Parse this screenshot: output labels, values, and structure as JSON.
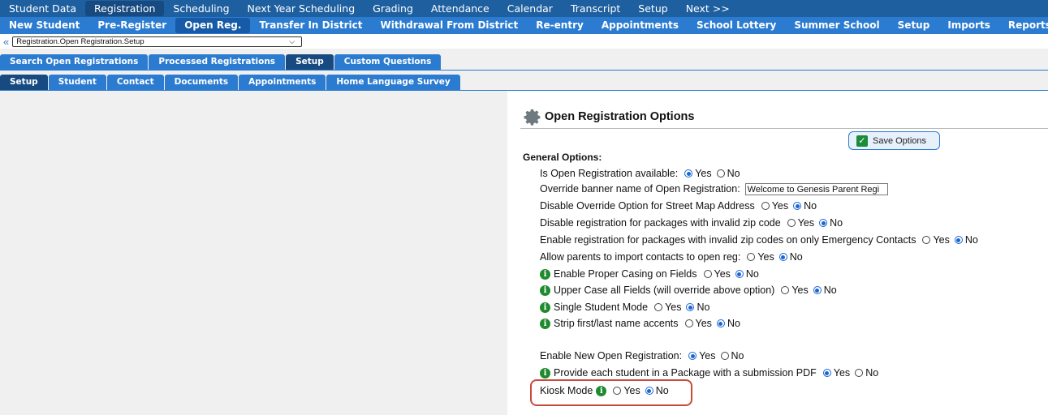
{
  "nav_primary": [
    {
      "label": "Student Data",
      "active": false
    },
    {
      "label": "Registration",
      "active": true
    },
    {
      "label": "Scheduling",
      "active": false
    },
    {
      "label": "Next Year Scheduling",
      "active": false
    },
    {
      "label": "Grading",
      "active": false
    },
    {
      "label": "Attendance",
      "active": false
    },
    {
      "label": "Calendar",
      "active": false
    },
    {
      "label": "Transcript",
      "active": false
    },
    {
      "label": "Setup",
      "active": false
    },
    {
      "label": "Next >>",
      "active": false
    }
  ],
  "nav_secondary": [
    {
      "label": "New Student",
      "active": false
    },
    {
      "label": "Pre-Register",
      "active": false
    },
    {
      "label": "Open Reg.",
      "active": true
    },
    {
      "label": "Transfer In District",
      "active": false
    },
    {
      "label": "Withdrawal From District",
      "active": false
    },
    {
      "label": "Re-entry",
      "active": false
    },
    {
      "label": "Appointments",
      "active": false
    },
    {
      "label": "School Lottery",
      "active": false
    },
    {
      "label": "Summer School",
      "active": false
    },
    {
      "label": "Setup",
      "active": false
    },
    {
      "label": "Imports",
      "active": false
    },
    {
      "label": "Reports",
      "active": false
    }
  ],
  "breadcrumb": {
    "back_icon": "double-chevron-left-icon",
    "selected": "Registration.Open Registration.Setup"
  },
  "tabs_top": [
    {
      "label": "Search Open Registrations",
      "active": false
    },
    {
      "label": "Processed Registrations",
      "active": false
    },
    {
      "label": "Setup",
      "active": true
    },
    {
      "label": "Custom Questions",
      "active": false
    }
  ],
  "tabs_sub": [
    {
      "label": "Setup",
      "active": true
    },
    {
      "label": "Student",
      "active": false
    },
    {
      "label": "Contact",
      "active": false
    },
    {
      "label": "Documents",
      "active": false
    },
    {
      "label": "Appointments",
      "active": false
    },
    {
      "label": "Home Language Survey",
      "active": false
    }
  ],
  "panel": {
    "title": "Open Registration Options",
    "save_label": "Save Options",
    "section_label": "General Options:",
    "yes": "Yes",
    "no": "No",
    "options": [
      {
        "label": "Is Open Registration available:",
        "info": false,
        "value": "yes"
      },
      {
        "label": "Override banner name of Open Registration:",
        "info": false,
        "input": "Welcome to Genesis Parent Regi"
      },
      {
        "label": "Disable Override Option for Street Map Address",
        "info": false,
        "value": "no"
      },
      {
        "label": "Disable registration for packages with invalid zip code",
        "info": false,
        "value": "no"
      },
      {
        "label": "Enable registration for packages with invalid zip codes on only Emergency Contacts",
        "info": false,
        "value": "no"
      },
      {
        "label": "Allow parents to import contacts to open reg:",
        "info": false,
        "value": "no"
      },
      {
        "label": "Enable Proper Casing on Fields",
        "info": true,
        "value": "no"
      },
      {
        "label": "Upper Case all Fields (will override above option)",
        "info": true,
        "value": "no"
      },
      {
        "label": "Single Student Mode",
        "info": true,
        "value": "no"
      },
      {
        "label": "Strip first/last name accents",
        "info": true,
        "value": "no"
      },
      {
        "label": "Enable New Open Registration:",
        "info": false,
        "value": "yes"
      },
      {
        "label": "Provide each student in a Package with a submission PDF",
        "info": true,
        "value": "yes"
      },
      {
        "label": "Kiosk Mode",
        "info": true,
        "info_after": true,
        "value": "no",
        "highlighted": true
      }
    ]
  },
  "colors": {
    "nav_primary_bg": "#1e5fa0",
    "nav_secondary_bg": "#2b7bd0",
    "tab_active_bg": "#174a80",
    "info_icon": "#1f8a2e",
    "highlight_border": "#c94a3c"
  }
}
